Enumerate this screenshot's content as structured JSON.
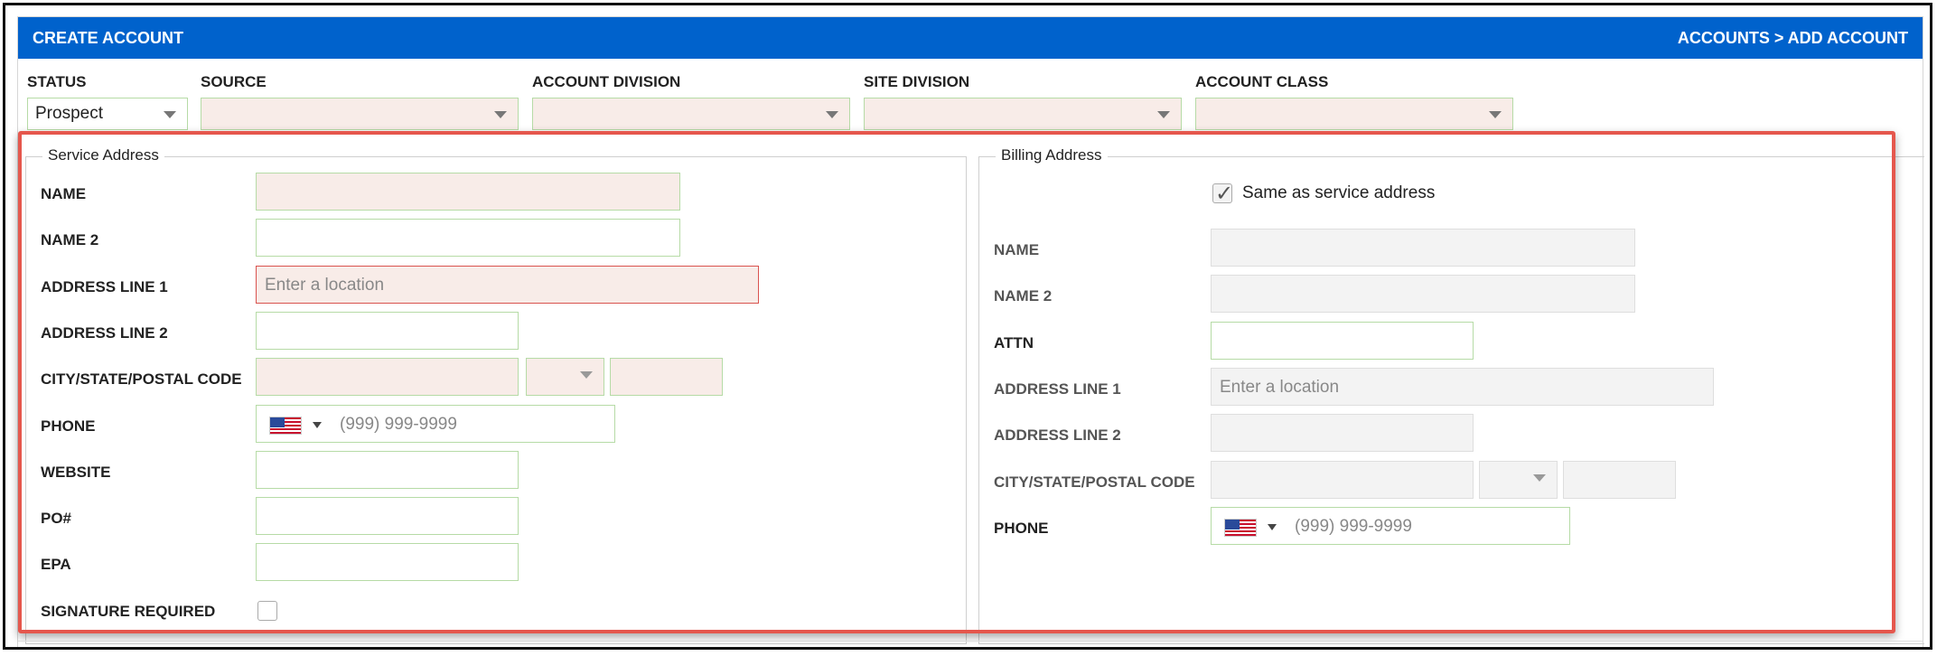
{
  "header": {
    "title": "CREATE ACCOUNT",
    "breadcrumb": "ACCOUNTS > ADD ACCOUNT"
  },
  "top_fields": {
    "status": {
      "label": "STATUS",
      "value": "Prospect"
    },
    "source": {
      "label": "SOURCE",
      "value": ""
    },
    "account_division": {
      "label": "ACCOUNT DIVISION",
      "value": ""
    },
    "site_division": {
      "label": "SITE DIVISION",
      "value": ""
    },
    "account_class": {
      "label": "ACCOUNT CLASS",
      "value": ""
    }
  },
  "service_address": {
    "legend": "Service Address",
    "name_label": "NAME",
    "name2_label": "NAME 2",
    "address1_label": "ADDRESS LINE 1",
    "address1_placeholder": "Enter a location",
    "address2_label": "ADDRESS LINE 2",
    "city_label": "CITY/STATE/POSTAL CODE",
    "phone_label": "PHONE",
    "phone_placeholder": "(999) 999-9999",
    "website_label": "WEBSITE",
    "po_label": "PO#",
    "epa_label": "EPA",
    "signature_label": "SIGNATURE REQUIRED",
    "signature_checked": false
  },
  "billing_address": {
    "legend": "Billing Address",
    "same_as_label": "Same as service address",
    "same_as_checked": true,
    "name_label": "NAME",
    "name2_label": "NAME 2",
    "attn_label": "ATTN",
    "address1_label": "ADDRESS LINE 1",
    "address1_placeholder": "Enter a location",
    "address2_label": "ADDRESS LINE 2",
    "city_label": "CITY/STATE/POSTAL CODE",
    "phone_label": "PHONE",
    "phone_placeholder": "(999) 999-9999"
  },
  "colors": {
    "header_bg": "#0062cc",
    "required_field_bg": "#f8ece8",
    "valid_border": "#b6dba6",
    "error_border": "#d9534f",
    "highlight_border": "#e5574d"
  }
}
